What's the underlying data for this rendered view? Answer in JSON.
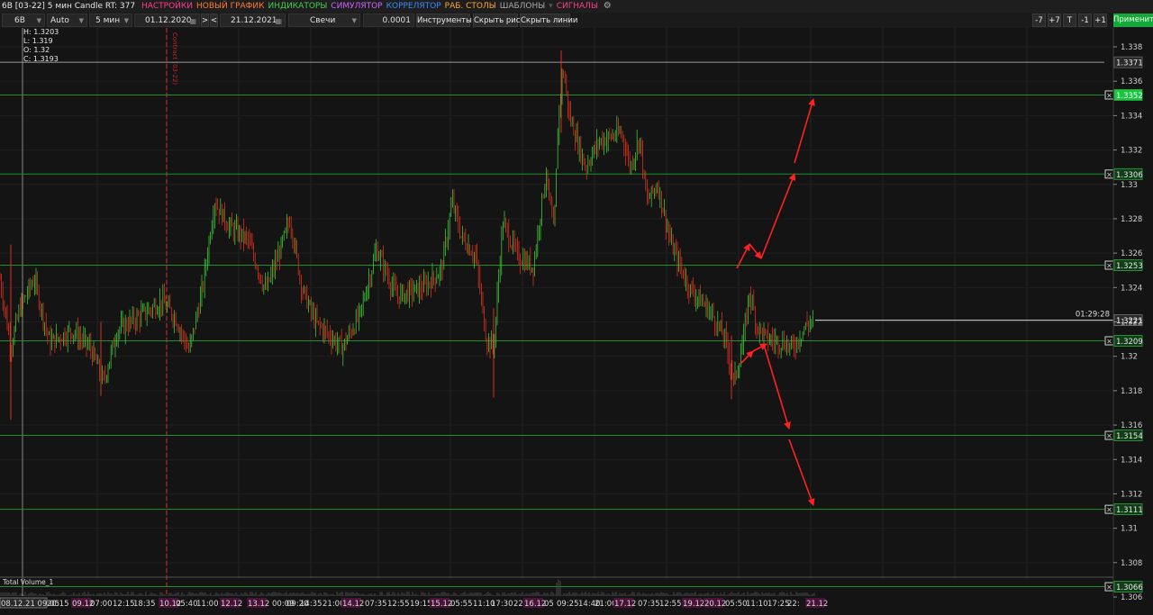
{
  "menubar": {
    "title": "6B [03-22] 5 мин Candle RT: 377",
    "items": [
      {
        "label": "НАСТРОЙКИ",
        "color": "#ff3b8d"
      },
      {
        "label": "НОВЫЙ ГРАФИК",
        "color": "#ff7a2b"
      },
      {
        "label": "ИНДИКАТОРЫ",
        "color": "#3fd04a"
      },
      {
        "label": "СИМУЛЯТОР",
        "color": "#d060ff"
      },
      {
        "label": "КОРРЕЛЯТОР",
        "color": "#3a8cff"
      },
      {
        "label": "РАБ. СТОЛЫ",
        "color": "#ffa52b"
      },
      {
        "label": "ШАБЛОНЫ",
        "color": "#aaaaaa"
      },
      {
        "label": "СИГНАЛЫ",
        "color": "#ff3b8d"
      }
    ]
  },
  "toolbar": {
    "symbol": "6B",
    "scale": "Auto",
    "timeframe": "5 мин",
    "date_from": "01.12.2020",
    "nav_next": ">",
    "nav_prev": "<",
    "date_to": "21.12.2021",
    "chart_type": "Свечи",
    "tick_size": "0.0001",
    "instruments": "Инструменты",
    "hide_drawings": "Скрыть рис.",
    "hide_lines": "Скрыть линии",
    "zoom_buttons": [
      "-7",
      "+7",
      "T",
      "-1",
      "+1"
    ],
    "apply": "Применить"
  },
  "ohlc": {
    "h": "H: 1.3203",
    "l": "L: 1.319",
    "o": "O: 1.32",
    "c": "C: 1.3193"
  },
  "price_axis": {
    "ticks": [
      "1.338",
      "1.336",
      "1.334",
      "1.332",
      "1.33",
      "1.328",
      "1.326",
      "1.324",
      "1.322",
      "1.32",
      "1.318",
      "1.316",
      "1.314",
      "1.312",
      "1.31",
      "1.308",
      "1.306"
    ],
    "current_price": "1.3221",
    "countdown": "01:29:28"
  },
  "levels": [
    {
      "price": "1.3371",
      "kind": "gray"
    },
    {
      "price": "1.3352",
      "kind": "green-highlight"
    },
    {
      "price": "1.3306",
      "kind": "green"
    },
    {
      "price": "1.3253",
      "kind": "green"
    },
    {
      "price": "1.3209",
      "kind": "green"
    },
    {
      "price": "1.3154",
      "kind": "green"
    },
    {
      "price": "1.3111",
      "kind": "green"
    },
    {
      "price": "1.3066",
      "kind": "green"
    }
  ],
  "time_axis": {
    "labels": [
      {
        "text": "08.12.21 09:05",
        "hl": "box"
      },
      {
        "text": "20:15",
        "hl": ""
      },
      {
        "text": "09.12",
        "hl": "pink"
      },
      {
        "text": "07:00",
        "hl": ""
      },
      {
        "text": "12:15",
        "hl": ""
      },
      {
        "text": "18:35",
        "hl": ""
      },
      {
        "text": "10.12",
        "hl": "pink"
      },
      {
        "text": "05:40",
        "hl": ""
      },
      {
        "text": "11:00",
        "hl": ""
      },
      {
        "text": "12.12",
        "hl": "pink"
      },
      {
        "text": "13.12",
        "hl": "pink"
      },
      {
        "text": "00:09",
        "hl": ""
      },
      {
        "text": "09:20",
        "hl": ""
      },
      {
        "text": "14:35",
        "hl": ""
      },
      {
        "text": "21:00",
        "hl": ""
      },
      {
        "text": "14.12",
        "hl": "pink"
      },
      {
        "text": "07:35",
        "hl": ""
      },
      {
        "text": "12:55",
        "hl": ""
      },
      {
        "text": "19:15",
        "hl": ""
      },
      {
        "text": "15.12",
        "hl": "pink"
      },
      {
        "text": "05:55",
        "hl": ""
      },
      {
        "text": "11:10",
        "hl": ""
      },
      {
        "text": "17:30",
        "hl": ""
      },
      {
        "text": "22:25",
        "hl": ""
      },
      {
        "text": "16.12",
        "hl": "pink"
      },
      {
        "text": "05",
        "hl": ""
      },
      {
        "text": "09:25",
        "hl": ""
      },
      {
        "text": "14:40",
        "hl": ""
      },
      {
        "text": "21:00",
        "hl": ""
      },
      {
        "text": "17.12",
        "hl": "pink"
      },
      {
        "text": "07:35",
        "hl": ""
      },
      {
        "text": "12:55",
        "hl": ""
      },
      {
        "text": "19.12",
        "hl": "pink"
      },
      {
        "text": "20.12",
        "hl": "pink"
      },
      {
        "text": "05:50",
        "hl": ""
      },
      {
        "text": "11:10",
        "hl": ""
      },
      {
        "text": "17:25",
        "hl": ""
      },
      {
        "text": "22:",
        "hl": ""
      },
      {
        "text": "21.12",
        "hl": "pink"
      }
    ]
  },
  "volume_panel": {
    "title": "Total Volume_1"
  },
  "vertical_marker": {
    "label": "Contract (03-22)"
  },
  "colors": {
    "bg": "#141414",
    "level_green": "#1f8f2c",
    "level_gray": "#9a9a9a",
    "candle_up": "#3ec437",
    "candle_down": "#d8311f",
    "arrow": "#ff2020",
    "highlight_green": "#17c83e"
  }
}
